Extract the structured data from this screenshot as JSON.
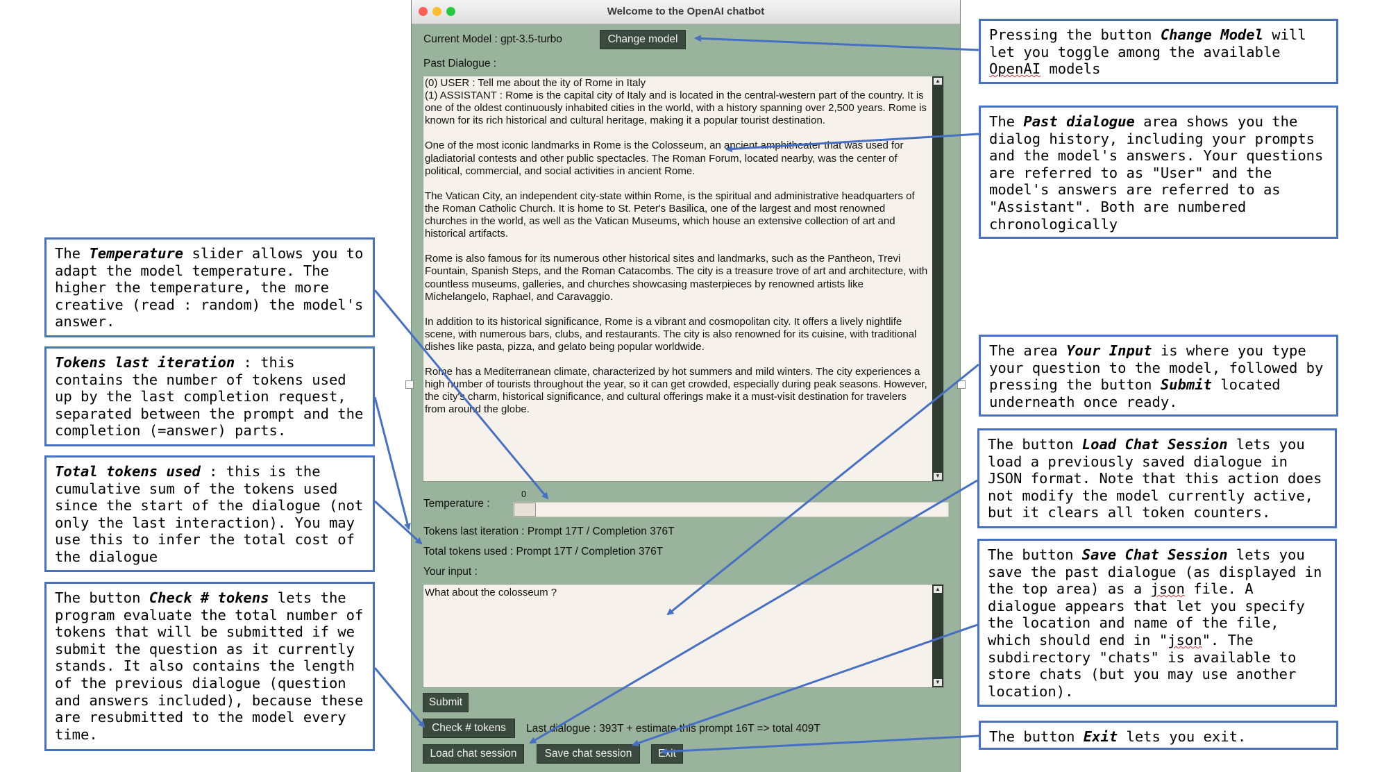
{
  "window": {
    "title": "Welcome to the OpenAI chatbot",
    "current_model_label": "Current Model : gpt-3.5-turbo",
    "change_model_button": "Change model",
    "past_dialogue_label": "Past Dialogue :",
    "past_dialogue_paragraphs": [
      "(0) USER : Tell me about the ity of Rome in Italy\n(1) ASSISTANT : Rome is the capital city of Italy and is located in the central-western part of the country. It is one of the oldest continuously inhabited cities in the world, with a history spanning over 2,500 years. Rome is known for its rich historical and cultural heritage, making it a popular tourist destination.",
      "One of the most iconic landmarks in Rome is the Colosseum, an ancient amphitheater that was used for gladiatorial contests and other public spectacles. The Roman Forum, located nearby, was the center of political, commercial, and social activities in ancient Rome.",
      "The Vatican City, an independent city-state within Rome, is the spiritual and administrative headquarters of the Roman Catholic Church. It is home to St. Peter's Basilica, one of the largest and most renowned churches in the world, as well as the Vatican Museums, which house an extensive collection of art and historical artifacts.",
      "Rome is also famous for its numerous other historical sites and landmarks, such as the Pantheon, Trevi Fountain, Spanish Steps, and the Roman Catacombs. The city is a treasure trove of art and architecture, with countless museums, galleries, and churches showcasing masterpieces by renowned artists like Michelangelo, Raphael, and Caravaggio.",
      "In addition to its historical significance, Rome is a vibrant and cosmopolitan city. It offers a lively nightlife scene, with numerous bars, clubs, and restaurants. The city is also renowned for its cuisine, with traditional dishes like pasta, pizza, and gelato being popular worldwide.",
      "Rome has a Mediterranean climate, characterized by hot summers and mild winters. The city experiences a high number of tourists throughout the year, so it can get crowded, especially during peak seasons. However, the city's charm, historical significance, and cultural offerings make it a must-visit destination for travelers from around the globe."
    ],
    "temperature_label": "Temperature :",
    "temperature_value": "0",
    "tokens_last_iteration": "Tokens last iteration : Prompt 17T / Completion 376T",
    "total_tokens_used": "Total tokens used : Prompt 17T / Completion 376T",
    "your_input_label": "Your input :",
    "your_input_value": "What about the colosseum ?",
    "submit_button": "Submit",
    "check_tokens_button": "Check # tokens",
    "token_estimate": "Last dialogue : 393T + estimate this prompt 16T => total 409T",
    "load_session_button": "Load chat session",
    "save_session_button": "Save chat session",
    "exit_button": "Exit"
  },
  "annotations": {
    "change_model": [
      "Pressing the button ",
      "Change Model",
      " will let you toggle among the available ",
      "OpenAI",
      " models"
    ],
    "past_dialogue": [
      "The ",
      "Past dialogue",
      " area shows you the dialog history, including your prompts and the model's answers. Your questions are referred to as \"User\" and the model's answers are referred to as \"Assistant\". Both are numbered chronologically"
    ],
    "temperature": [
      "The ",
      "Temperature",
      " slider allows you to adapt the model temperature. The higher the temperature, the more creative (read : random) the model's answer."
    ],
    "tokens_last": [
      "Tokens last iteration",
      " : this contains the number of tokens used up by the last completion request, separated between the prompt and the completion (=answer) parts."
    ],
    "total_tokens": [
      "Total tokens used",
      " : this is the cumulative sum of the tokens used since the start of the dialogue (not only the last interaction). You may use this to infer the total cost of the dialogue"
    ],
    "check_tokens": [
      "The button ",
      "Check # tokens",
      " lets the program evaluate the total number of tokens that will be submitted if we submit the question as it currently stands. It also contains the length of the previous dialogue (question and answers included), because these are resubmitted to the model every time."
    ],
    "your_input": [
      "The area ",
      "Your Input",
      " is where you type your question to the model, followed by pressing the button ",
      "Submit",
      " located underneath once ready."
    ],
    "load_session": [
      "The button ",
      "Load Chat Session",
      " lets you load a previously saved dialogue in JSON format. Note that this action does not modify the model currently active, but it clears all token counters."
    ],
    "save_session": [
      "The button ",
      "Save Chat Session",
      " lets you save the past dialogue (as displayed in the top area) as a ",
      "json",
      " file. A dialogue appears that let you specify the location and name of the file, which should end in \"",
      "json",
      "\". The subdirectory \"chats\" is available to store chats (but you may use another location)."
    ],
    "exit": [
      "The button ",
      "Exit",
      " lets you exit."
    ]
  },
  "colors": {
    "window_bg": "#99b39c",
    "button_bg": "#3b4a3e",
    "textarea_bg": "#f6f1ea",
    "annotation_border": "#4670c3",
    "arrow": "#4670c3"
  }
}
